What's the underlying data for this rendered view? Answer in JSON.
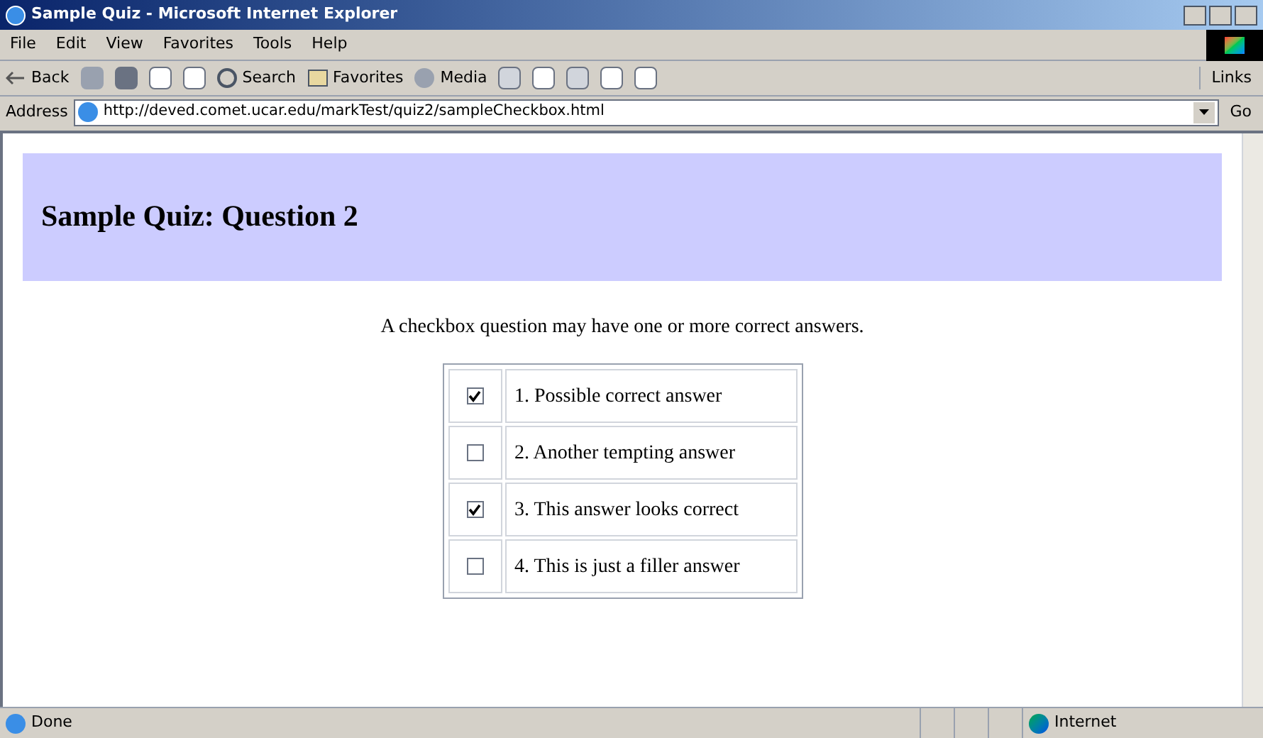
{
  "window": {
    "title": "Sample Quiz - Microsoft Internet Explorer"
  },
  "menu": [
    "File",
    "Edit",
    "View",
    "Favorites",
    "Tools",
    "Help"
  ],
  "toolbar": {
    "back": "Back",
    "search": "Search",
    "favorites": "Favorites",
    "media": "Media",
    "links": "Links"
  },
  "address_bar": {
    "label": "Address",
    "value": "http://deved.comet.ucar.edu/markTest/quiz2/sampleCheckbox.html",
    "go": "Go"
  },
  "page": {
    "heading": "Sample Quiz: Question 2",
    "instructions": "A checkbox question may have one or more correct answers.",
    "answers": [
      {
        "label": "1. Possible correct answer",
        "checked": true
      },
      {
        "label": "2. Another tempting answer",
        "checked": false
      },
      {
        "label": "3. This answer looks correct",
        "checked": true
      },
      {
        "label": "4. This is just a filler answer",
        "checked": false
      }
    ]
  },
  "status_bar": {
    "text": "Done",
    "zone": "Internet"
  }
}
